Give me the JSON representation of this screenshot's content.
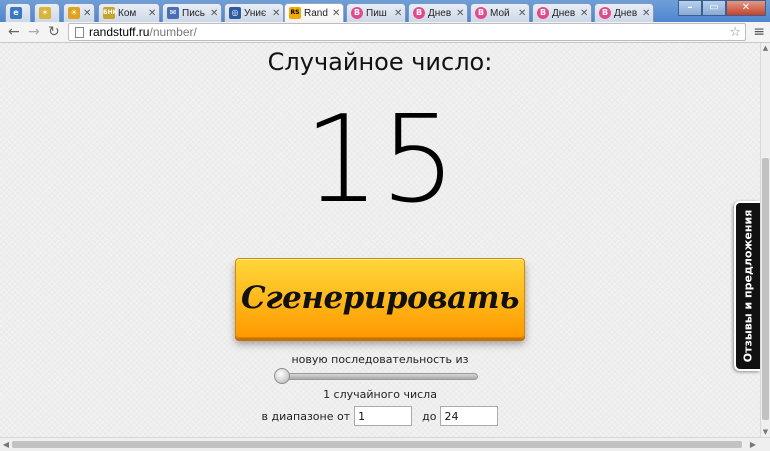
{
  "tabs": [
    {
      "title": "",
      "icon": "chrome-app-icon",
      "color": "#3b78c4"
    },
    {
      "title": "",
      "icon": "doodle-icon",
      "color": "#d9b43a"
    },
    {
      "title": "",
      "icon": "sun-icon",
      "color": "#e0a21a"
    },
    {
      "title": "Ком",
      "icon": "bnk-icon",
      "color": "#c9a227"
    },
    {
      "title": "Пись",
      "icon": "mail-icon",
      "color": "#4a6fb5"
    },
    {
      "title": "Униє",
      "icon": "globe-icon",
      "color": "#2b5aa0"
    },
    {
      "title": "Rand",
      "icon": "rs-icon",
      "color": "#f2a900",
      "active": true
    },
    {
      "title": "Пиш",
      "icon": "b-icon",
      "color": "#e24b8b"
    },
    {
      "title": "Днев",
      "icon": "b-icon",
      "color": "#e24b8b"
    },
    {
      "title": "Мой",
      "icon": "b-icon",
      "color": "#e24b8b"
    },
    {
      "title": "Днев",
      "icon": "b-icon",
      "color": "#e24b8b"
    },
    {
      "title": "Днев",
      "icon": "b-icon",
      "color": "#e24b8b"
    }
  ],
  "address": {
    "host": "randstuff.ru",
    "path": "/number/"
  },
  "page": {
    "heading": "Случайное число:",
    "number": "15",
    "generate_label": "Сгенерировать",
    "sequence_label": "новую последовательность из",
    "count_label": "1 случайного числа",
    "slider_value": 1,
    "range_from_label": "в диапазоне от",
    "range_from_value": "1",
    "range_to_label": "до",
    "range_to_value": "24",
    "feedback_label": "Отзывы и предложения"
  },
  "colors": {
    "accent": "#ffb400",
    "feedback_bg": "#111111"
  }
}
